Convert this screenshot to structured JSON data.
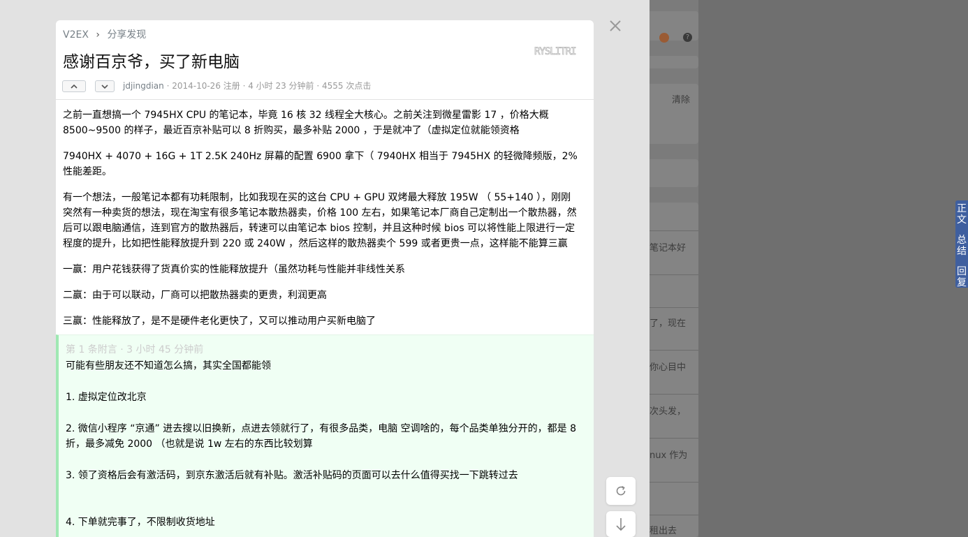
{
  "background_page": {
    "snippets": [
      "清除",
      "笔记本好",
      "了，现在",
      "你心目中",
      "次头发，",
      "nux 作为",
      "租出去"
    ],
    "side_tabs": [
      "正文",
      "总结",
      "回复"
    ]
  },
  "modal": {
    "breadcrumb": {
      "home": "V2EX",
      "separator": "›",
      "node": "分享发现"
    },
    "title": "感谢百京爷，买了新电脑",
    "logo_text": "RYSLITRI",
    "meta": {
      "author": "jdjingdian",
      "joined": " · 2014-10-26 注册 · 4 小时 23 分钟前 · 4555 次点击"
    },
    "paragraphs": [
      "之前一直想搞一个 7945HX CPU 的笔记本，毕竟 16 核 32 线程全大核心。之前关注到微星雷影 17 ，价格大概 8500~9500 的样子，最近百京补贴可以 8 折购买，最多补贴 2000 ，于是就冲了（虚拟定位就能领资格",
      "7940HX + 4070 + 16G + 1T 2.5K 240Hz 屏幕的配置 6900 拿下（ 7940HX 相当于 7945HX 的轻微降频版，2%性能差距。",
      "有一个想法，一般笔记本都有功耗限制，比如我现在买的这台 CPU + GPU 双烤最大释放 195W （ 55+140 ），刚刚突然有一种卖货的想法，现在淘宝有很多笔记本散热器卖，价格 100 左右，如果笔记本厂商自己定制出一个散热器，然后可以跟电脑通信，连到官方的散热器后，转速可以由笔记本 bios 控制，并且这种时候 bios 可以将性能上限进行一定程度的提升，比如把性能释放提升到 220 或 240W ，然后这样的散热器卖个 599 或者更贵一点，这样能不能算三赢",
      "一赢：用户花钱获得了货真价实的性能释放提升（虽然功耗与性能并非线性关系",
      "二赢：由于可以联动，厂商可以把散热器卖的更贵，利润更高",
      "三赢：性能释放了，是不是硬件老化更快了，又可以推动用户买新电脑了"
    ],
    "append": {
      "header": "第 1 条附言  ·  3 小时 45 分钟前",
      "lines": [
        "可能有些朋友还不知道怎么搞，其实全国都能领",
        "1. 虚拟定位改北京",
        "2. 微信小程序 “京通” 进去搜以旧换新，点进去领就行了，有很多品类，电脑 空调啥的，每个品类单独分开的，都是 8 折，最多减免 2000 （也就是说 1w 左右的东西比较划算",
        "3. 领了资格后会有激活码，到京东激活后就有补贴。激活补贴码的页面可以去什么值得买找一下跳转过去",
        "4. 下单就完事了，不限制收货地址"
      ]
    }
  },
  "icons": {
    "close": "close-icon",
    "refresh": "refresh-icon",
    "scroll_down": "arrow-down-icon",
    "upvote": "chevron-up-icon",
    "downvote": "chevron-down-icon"
  },
  "colors": {
    "accent_blue": "#3f5f9f",
    "append_bg": "#f0fff4",
    "append_border": "#9fe8b3"
  }
}
